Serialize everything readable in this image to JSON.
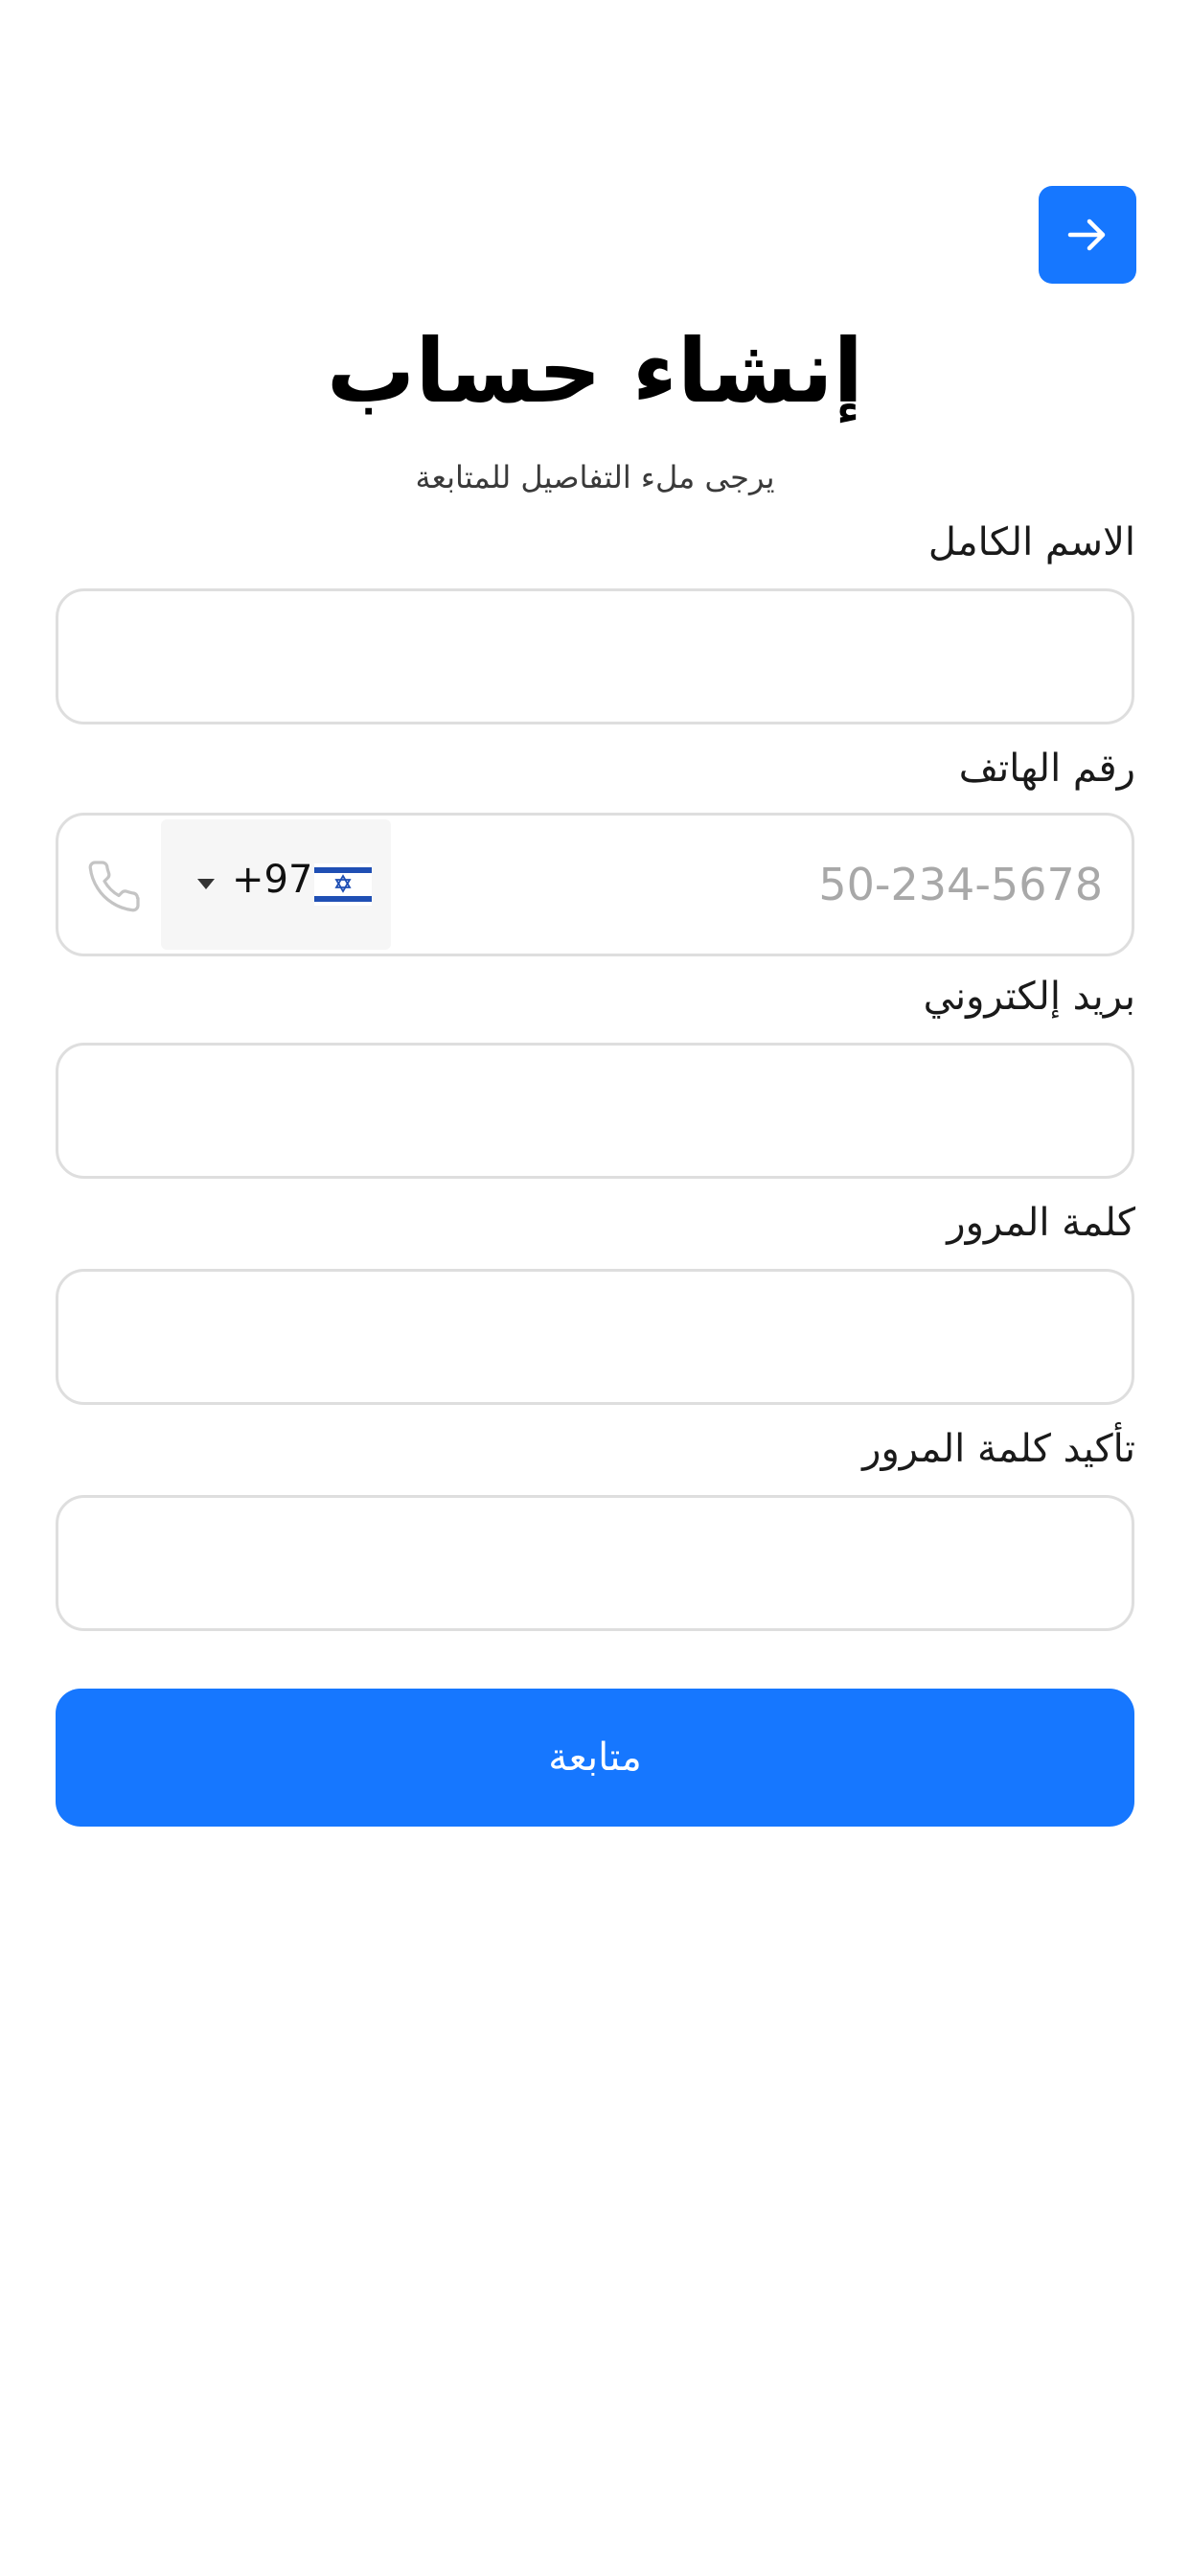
{
  "header": {
    "back_icon": "arrow-right-icon",
    "accent_color": "#1677FF"
  },
  "title": "إنشاء حساب",
  "subtitle": "يرجى ملء التفاصيل للمتابعة",
  "form": {
    "full_name": {
      "label": "الاسم الكامل",
      "value": "",
      "placeholder": ""
    },
    "phone": {
      "label": "رقم الهاتف",
      "dial_code": "+972",
      "country_flag": "israel-flag-icon",
      "placeholder": "50-234-5678",
      "value": "",
      "icon": "phone-icon"
    },
    "email": {
      "label": "بريد إلكتروني",
      "value": "",
      "placeholder": ""
    },
    "password": {
      "label": "كلمة المرور",
      "value": "",
      "placeholder": ""
    },
    "confirm_password": {
      "label": "تأكيد كلمة المرور",
      "value": "",
      "placeholder": ""
    }
  },
  "submit": {
    "label": "متابعة"
  }
}
